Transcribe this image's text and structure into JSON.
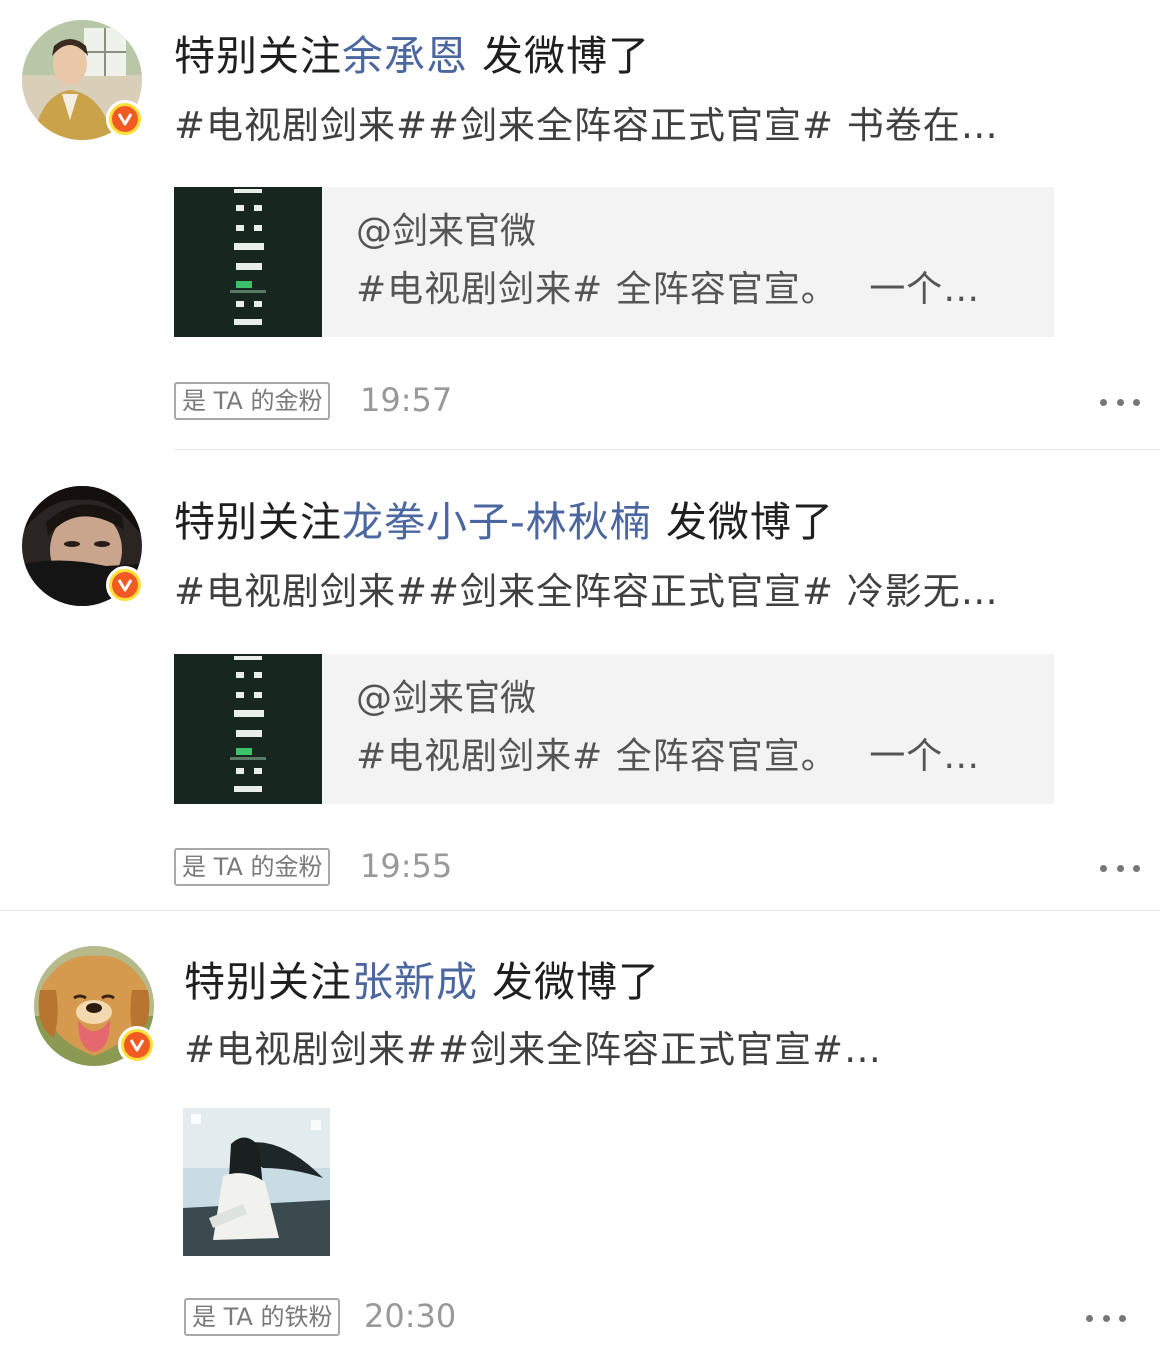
{
  "posts": [
    {
      "prefix": "特别关注",
      "username": "余承恩",
      "suffix": " 发微博了",
      "snippet": "#电视剧剑来##剑来全阵容正式官宣# 书卷在…",
      "repost": {
        "source": "@剑来官微",
        "text": "#电视剧剑来# 全阵容官宣。　 一个…"
      },
      "fan_badge": "是 TA 的金粉",
      "time": "19:57"
    },
    {
      "prefix": "特别关注",
      "username": "龙拳小子-林秋楠",
      "suffix": " 发微博了",
      "snippet": "#电视剧剑来##剑来全阵容正式官宣# 冷影无…",
      "repost": {
        "source": "@剑来官微",
        "text": "#电视剧剑来# 全阵容官宣。　 一个…"
      },
      "fan_badge": "是 TA 的金粉",
      "time": "19:55"
    },
    {
      "prefix": "特别关注",
      "username": "张新成",
      "suffix": " 发微博了",
      "snippet": "#电视剧剑来##剑来全阵容正式官宣#…",
      "fan_badge": "是 TA 的铁粉",
      "time": "20:30"
    }
  ],
  "colors": {
    "username": "#4c67a0",
    "verified_badge": "#f15a22",
    "badge_ring": "#ffdf3a",
    "time": "#999999"
  }
}
